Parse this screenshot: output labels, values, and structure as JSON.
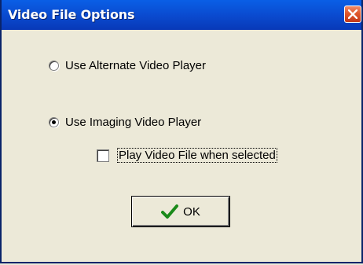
{
  "window": {
    "title": "Video File Options"
  },
  "options": {
    "alternate_label": "Use Alternate Video Player",
    "alternate_selected": false,
    "imaging_label": "Use Imaging Video Player",
    "imaging_selected": true,
    "play_label": "Play Video File when selected",
    "play_checked": false
  },
  "buttons": {
    "ok_label": "OK"
  },
  "icons": {
    "close": "close-icon",
    "ok": "checkmark-icon"
  },
  "colors": {
    "titlebar": "#0a4bd0",
    "close": "#e0572b",
    "checkmark": "#1a8a1a"
  }
}
